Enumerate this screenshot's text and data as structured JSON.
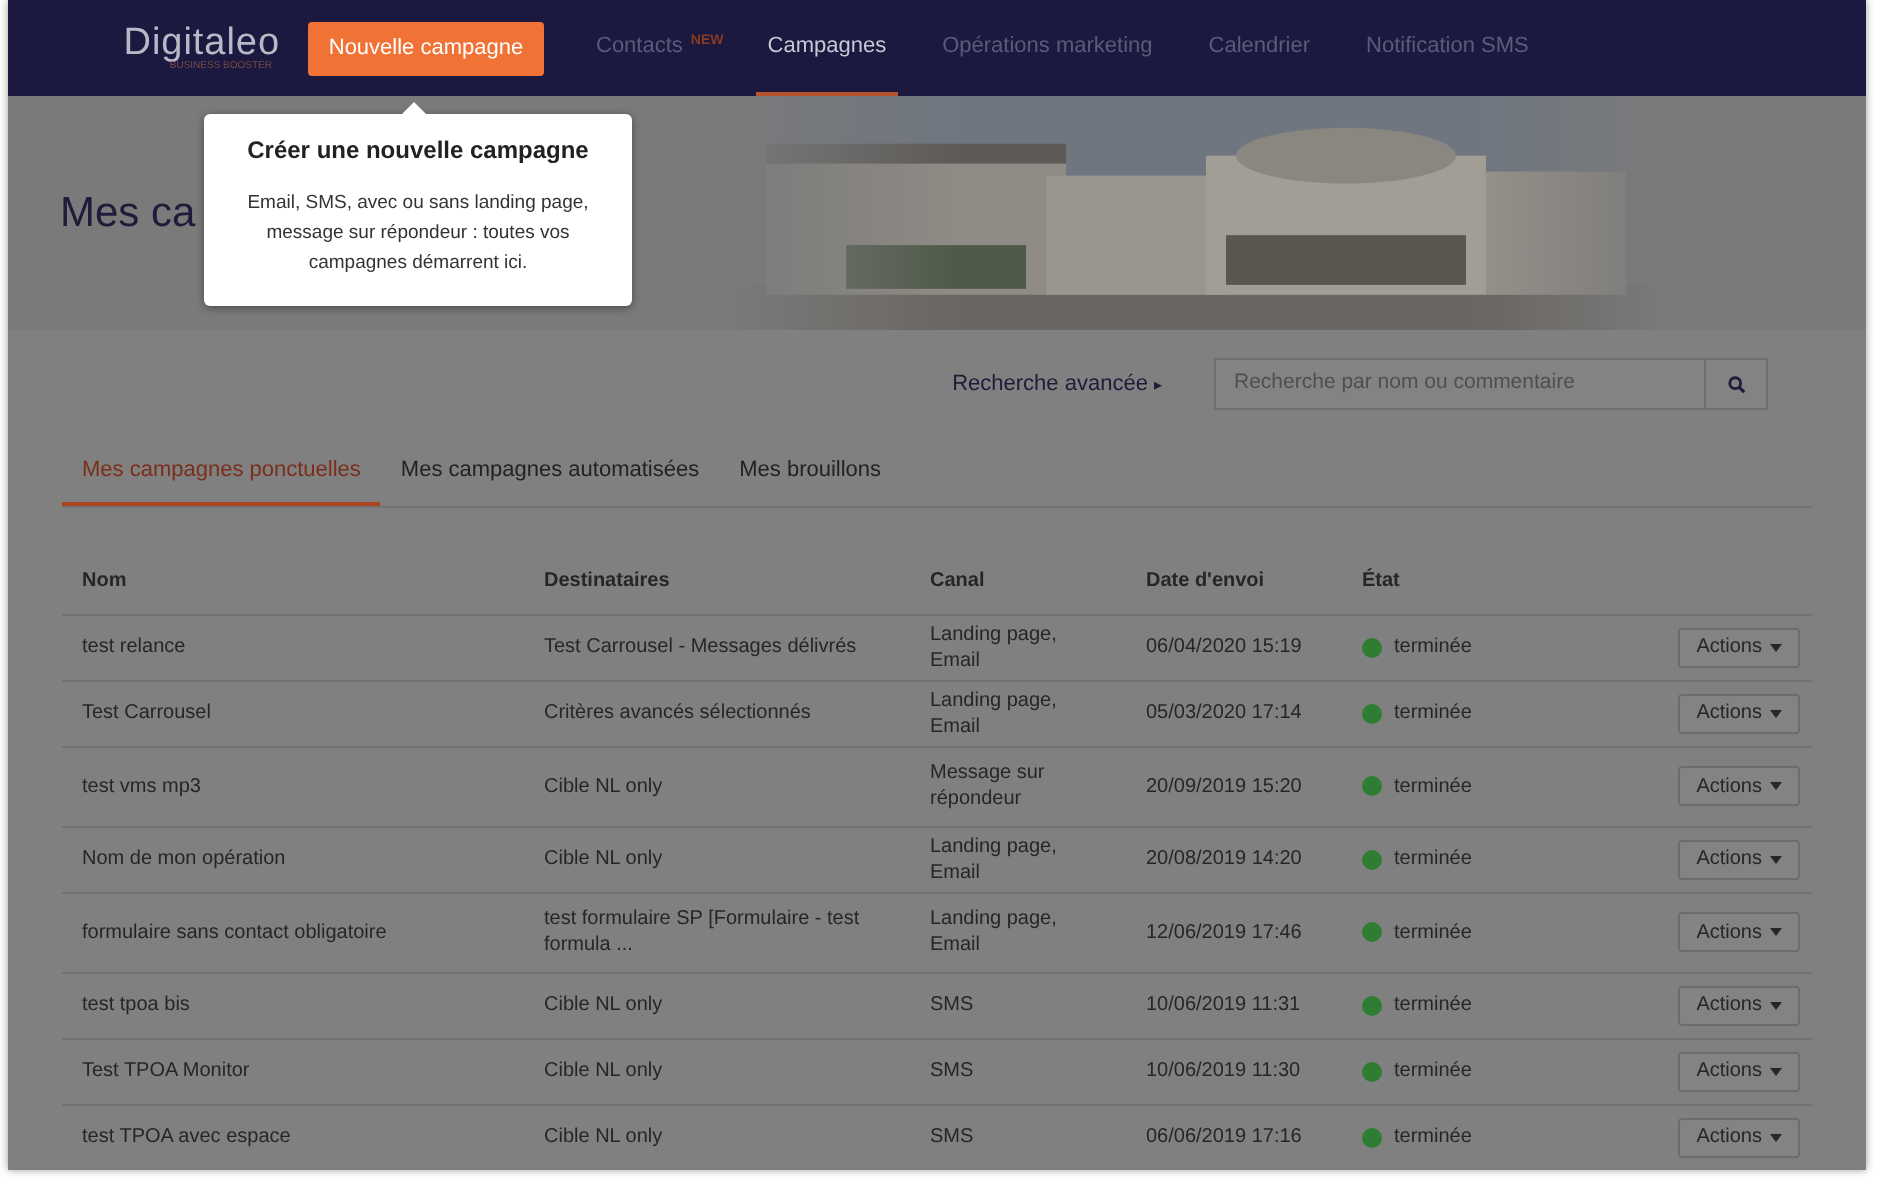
{
  "header": {
    "logo": "Digitaleo",
    "logo_tagline": "BUSINESS BOOSTER",
    "new_button": "Nouvelle campagne",
    "nav": [
      {
        "label": "Contacts",
        "badge": "NEW",
        "selected": false
      },
      {
        "label": "Campagnes",
        "selected": true
      },
      {
        "label": "Opérations marketing",
        "selected": false
      },
      {
        "label": "Calendrier",
        "selected": false
      },
      {
        "label": "Notification SMS",
        "selected": false
      }
    ]
  },
  "tooltip": {
    "title": "Créer une nouvelle campagne",
    "text": "Email, SMS, avec ou sans landing page, message sur répondeur : toutes vos campagnes démarrent ici."
  },
  "hero": {
    "title": "Mes ca"
  },
  "search": {
    "advanced_link": "Recherche avancée",
    "advanced_arrow": "▸",
    "placeholder": "Recherche par nom ou commentaire"
  },
  "tabs": [
    {
      "label": "Mes campagnes ponctuelles",
      "selected": true
    },
    {
      "label": "Mes campagnes automatisées",
      "selected": false
    },
    {
      "label": "Mes brouillons",
      "selected": false
    }
  ],
  "table": {
    "columns": [
      "Nom",
      "Destinataires",
      "Canal",
      "Date d'envoi",
      "État"
    ],
    "rows": [
      {
        "name": "test relance",
        "recipients": "Test Carrousel - Messages délivrés",
        "channel": "Landing page, Email",
        "date": "06/04/2020 15:19",
        "status": "terminée",
        "color": "#2e7d32",
        "action": "Actions"
      },
      {
        "name": "Test Carrousel",
        "recipients": "Critères avancés sélectionnés",
        "channel": "Landing page, Email",
        "date": "05/03/2020 17:14",
        "status": "terminée",
        "color": "#2e7d32",
        "action": "Actions"
      },
      {
        "name": "test vms mp3",
        "recipients": "Cible NL only",
        "channel": "Message sur répondeur",
        "date": "20/09/2019 15:20",
        "status": "terminée",
        "color": "#2e7d32",
        "action": "Actions"
      },
      {
        "name": "Nom de mon opération",
        "recipients": "Cible NL only",
        "channel": "Landing page, Email",
        "date": "20/08/2019 14:20",
        "status": "terminée",
        "color": "#2e7d32",
        "action": "Actions"
      },
      {
        "name": "formulaire sans contact obligatoire",
        "recipients": "test formulaire SP [Formulaire - test formula ...",
        "channel": "Landing page, Email",
        "date": "12/06/2019 17:46",
        "status": "terminée",
        "color": "#2e7d32",
        "action": "Actions"
      },
      {
        "name": "test tpoa bis",
        "recipients": "Cible NL only",
        "channel": "SMS",
        "date": "10/06/2019 11:31",
        "status": "terminée",
        "color": "#2e7d32",
        "action": "Actions"
      },
      {
        "name": "Test TPOA Monitor",
        "recipients": "Cible NL only",
        "channel": "SMS",
        "date": "10/06/2019 11:30",
        "status": "terminée",
        "color": "#2e7d32",
        "action": "Actions"
      },
      {
        "name": "test TPOA avec espace",
        "recipients": "Cible NL only",
        "channel": "SMS",
        "date": "06/06/2019 17:16",
        "status": "terminée",
        "color": "#2e7d32",
        "action": "Actions"
      }
    ]
  }
}
